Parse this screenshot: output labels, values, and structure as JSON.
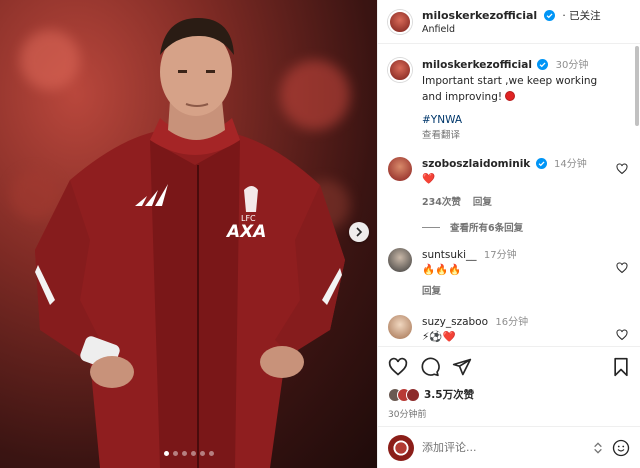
{
  "post": {
    "username": "miloskerkezofficial",
    "follow_status": "· 已关注",
    "location": "Anfield",
    "caption": "Important start ,we keep working and improving!",
    "caption_time": "30分钟",
    "hashtag": "#YNWA",
    "translate": "查看翻译"
  },
  "comments": [
    {
      "username": "szoboszlaidominik",
      "time": "14分钟",
      "text": "❤️",
      "likes": "234次赞",
      "reply": "回复",
      "view_replies": "查看所有6条回复"
    },
    {
      "username": "suntsuki__",
      "time": "17分钟",
      "text": "🔥🔥🔥",
      "reply": "回复"
    },
    {
      "username": "suzy_szaboo",
      "time": "16分钟",
      "text": "⚡⚽❤️"
    }
  ],
  "actions": {
    "like_icon": "heart-icon",
    "comment_icon": "comment-icon",
    "share_icon": "share-icon",
    "save_icon": "bookmark-icon"
  },
  "likes_count": "3.5万次赞",
  "posted_time": "30分钟前",
  "add_comment_placeholder": "添加评论...",
  "carousel": {
    "total": 6,
    "active": 0
  },
  "colors": {
    "verified": "#0095f6",
    "hashtag": "#00376b",
    "heart": "#ed4956"
  }
}
